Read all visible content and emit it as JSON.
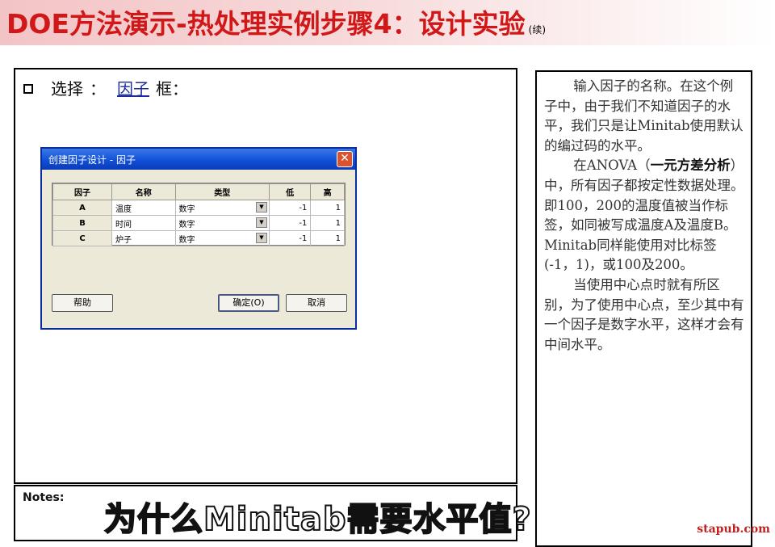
{
  "slide": {
    "title": "DOE方法演示-热处理实例步骤4：设计实验",
    "title_tail": "(续)"
  },
  "main": {
    "bullet_text": "选择",
    "colon": "：",
    "link_text": "因子",
    "after_link": "框："
  },
  "dialog": {
    "title": "创建因子设计 - 因子",
    "close_glyph": "✕",
    "columns": [
      "因子",
      "名称",
      "类型",
      "低",
      "高"
    ],
    "rows": [
      {
        "factor": "A",
        "name": "温度",
        "type": "数字",
        "low": "-1",
        "high": "1"
      },
      {
        "factor": "B",
        "name": "时间",
        "type": "数字",
        "low": "-1",
        "high": "1"
      },
      {
        "factor": "C",
        "name": "炉子",
        "type": "数字",
        "low": "-1",
        "high": "1"
      }
    ],
    "help_label": "帮助",
    "ok_label": "确定(O)",
    "cancel_label": "取消",
    "dropdown_glyph": "▼"
  },
  "side": {
    "p1": "输入因子的名称。在这个例子中，由于我们不知道因子的水平，我们只是让Minitab使用默认的编过码的水平。",
    "p2_a": "在ANOVA（",
    "p2_bold": "一元方差分析",
    "p2_b": "）中，所有因子都按定性数据处理。即100，200的温度值被当作标签，如同被写成温度A及温度B。Minitab同样能使用对比标签(-1，1)，或100及200。",
    "p3": "当使用中心点时就有所区别，为了使用中心点，至少其中有一个因子是数字水平，这样才会有中间水平。"
  },
  "notes": {
    "label": "Notes:",
    "big_text": "为什么Minitab需要水平值?"
  },
  "watermark": "stapub.com",
  "colors": {
    "title": "#d01818",
    "title_bg": "#f3c4c6",
    "dialog_titlebar": "#1250d8",
    "link": "#1a2a9a"
  }
}
